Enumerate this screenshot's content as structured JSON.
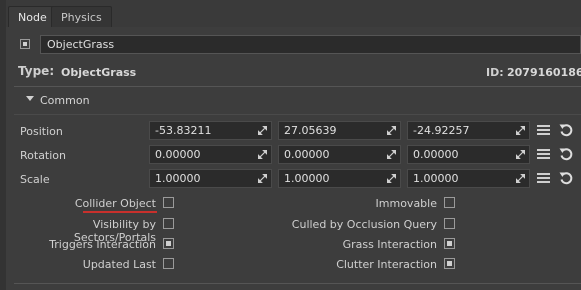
{
  "tabs": [
    {
      "label": "Node"
    },
    {
      "label": "Physics"
    }
  ],
  "node": {
    "name_value": "ObjectGrass",
    "type_label": "Type:",
    "type_value": "ObjectGrass",
    "id_label": "ID:",
    "id_value": "2079160186"
  },
  "common": {
    "label": "Common",
    "rows": [
      {
        "label": "Position",
        "values": [
          "-53.83211",
          "27.05639",
          "-24.92257"
        ]
      },
      {
        "label": "Rotation",
        "values": [
          "0.00000",
          "0.00000",
          "0.00000"
        ]
      },
      {
        "label": "Scale",
        "values": [
          "1.00000",
          "1.00000",
          "1.00000"
        ]
      }
    ]
  },
  "flags": {
    "left": [
      {
        "label": "Collider Object",
        "checked": false
      },
      {
        "label": "Visibility by Sectors/Portals",
        "checked": false
      },
      {
        "label": "Triggers Interaction",
        "checked": true
      },
      {
        "label": "Updated Last",
        "checked": false
      }
    ],
    "right": [
      {
        "label": "Immovable",
        "checked": false
      },
      {
        "label": "Culled by Occlusion Query",
        "checked": false
      },
      {
        "label": "Grass Interaction",
        "checked": true
      },
      {
        "label": "Clutter Interaction",
        "checked": true
      }
    ]
  },
  "colors": {
    "background": "#3d3d3d",
    "field_bg": "#2b2b2b",
    "text": "#d0d0d0",
    "highlight_underline": "#c8302c"
  }
}
